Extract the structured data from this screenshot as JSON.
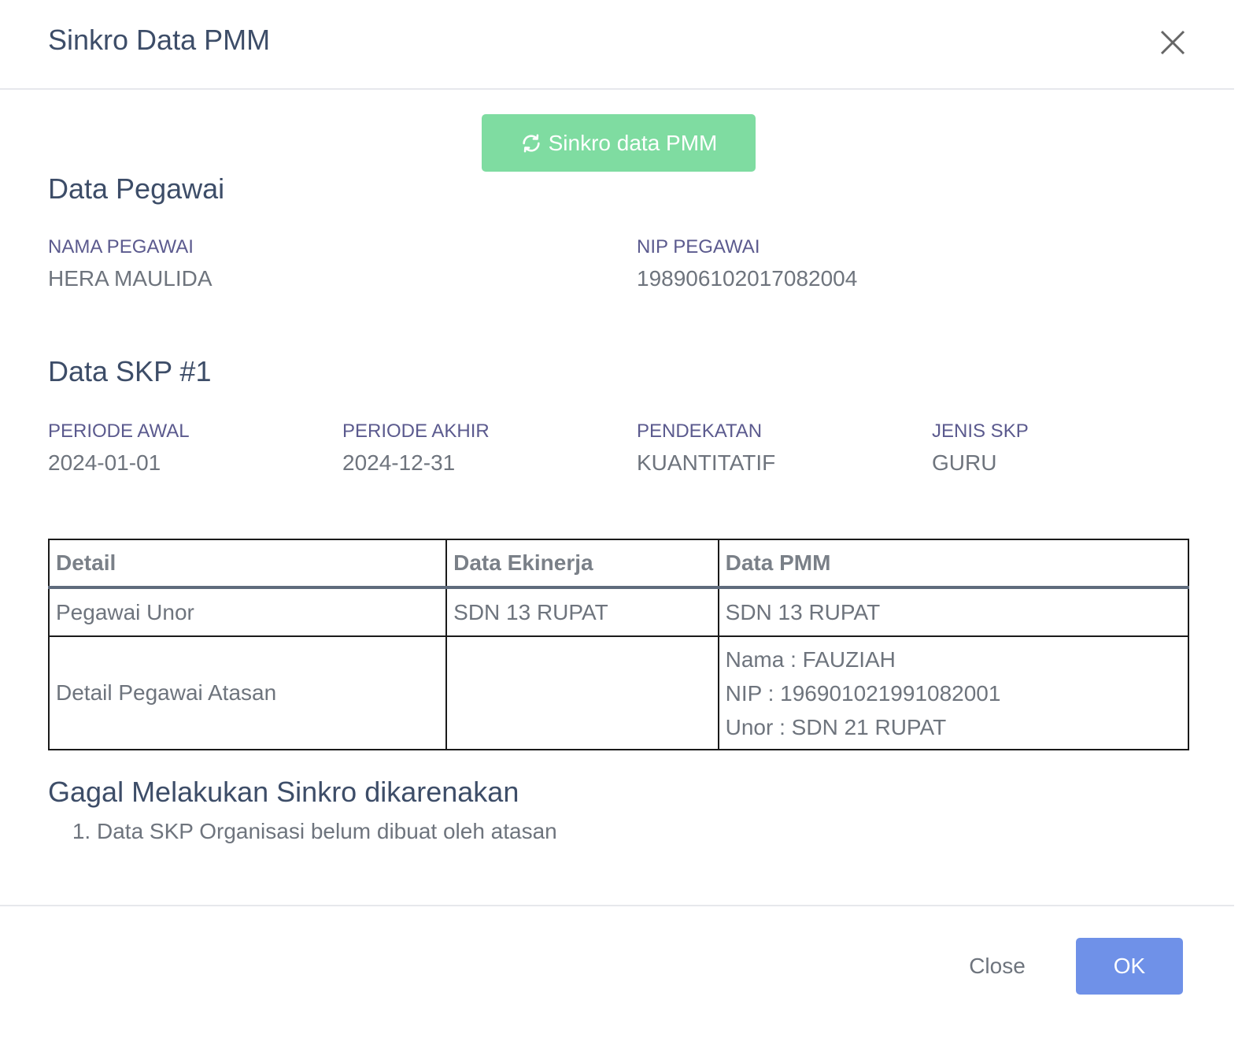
{
  "modal": {
    "title": "Sinkro Data PMM"
  },
  "sync_button": {
    "label": "Sinkro data PMM",
    "icon": "refresh-icon",
    "color": "#7fdca1"
  },
  "pegawai": {
    "heading": "Data Pegawai",
    "nama_label": "NAMA PEGAWAI",
    "nama_value": "HERA MAULIDA",
    "nip_label": "NIP PEGAWAI",
    "nip_value": "198906102017082004"
  },
  "skp": {
    "heading": "Data SKP #1",
    "fields": [
      {
        "label": "PERIODE AWAL",
        "value": "2024-01-01"
      },
      {
        "label": "PERIODE AKHIR",
        "value": "2024-12-31"
      },
      {
        "label": "PENDEKATAN",
        "value": "KUANTITATIF"
      },
      {
        "label": "JENIS SKP",
        "value": "GURU"
      }
    ]
  },
  "table": {
    "headers": [
      "Detail",
      "Data Ekinerja",
      "Data PMM"
    ],
    "row1": {
      "detail": "Pegawai Unor",
      "ekinerja": "SDN 13 RUPAT",
      "pmm": "SDN 13 RUPAT"
    },
    "row2": {
      "detail": "Detail Pegawai Atasan",
      "ekinerja": "",
      "pmm_lines": [
        "Nama : FAUZIAH",
        "NIP : 196901021991082001",
        "Unor : SDN 21 RUPAT"
      ]
    }
  },
  "failure": {
    "heading": "Gagal Melakukan Sinkro dikarenakan",
    "reasons": [
      "Data SKP Organisasi belum dibuat oleh atasan"
    ]
  },
  "footer": {
    "close_label": "Close",
    "ok_label": "OK",
    "ok_color": "#6f91e8"
  }
}
